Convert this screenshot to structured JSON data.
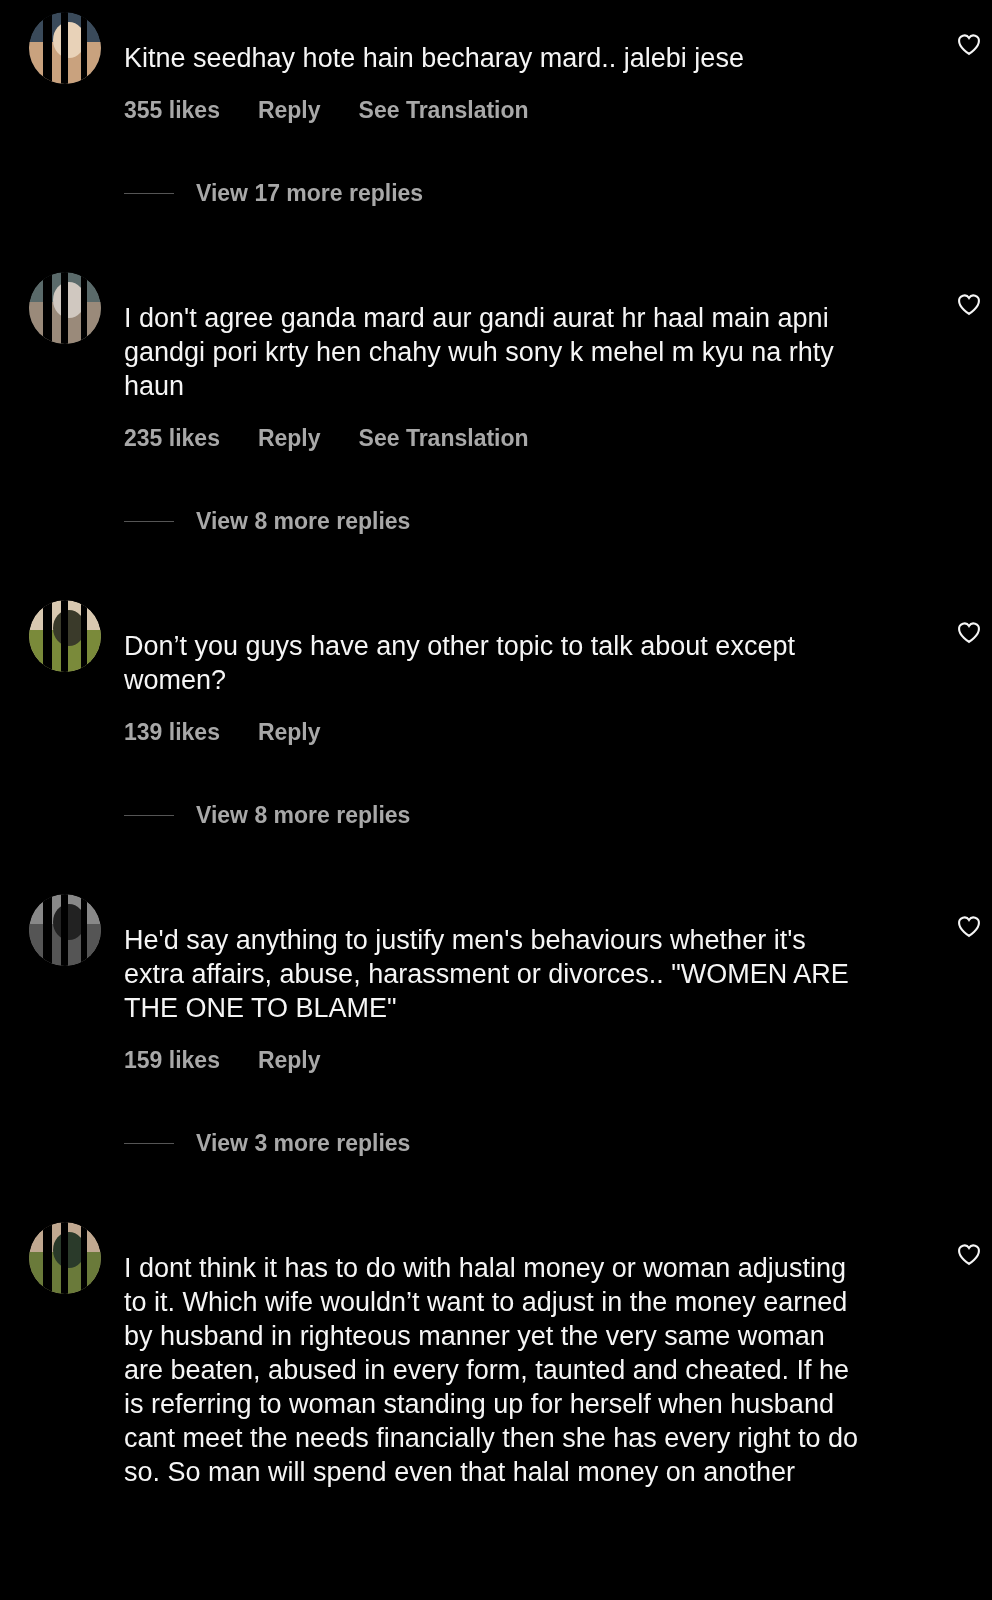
{
  "comments": [
    {
      "text": "Kitne seedhay hote hain becharay mard.. jalebi jese",
      "liked": false,
      "likes": "355 likes",
      "reply": "Reply",
      "translation": "See Translation",
      "more_replies": "View 17 more replies"
    },
    {
      "text": "I don't agree ganda mard aur gandi aurat hr  haal main apni gandgi pori krty hen chahy wuh sony k mehel m kyu na rhty haun",
      "liked": false,
      "likes": "235 likes",
      "reply": "Reply",
      "translation": "See Translation",
      "more_replies": "View 8 more replies"
    },
    {
      "text": "Don’t you guys have any other topic to talk about except women?",
      "liked": false,
      "likes": "139 likes",
      "reply": "Reply",
      "more_replies": "View 8 more replies"
    },
    {
      "text": "He'd say anything to justify men's behaviours whether it's extra affairs, abuse, harassment or divorces.. \"WOMEN ARE THE ONE TO BLAME\"",
      "liked": false,
      "likes": "159 likes",
      "reply": "Reply",
      "more_replies": "View 3 more replies"
    },
    {
      "text": "I dont think it has to do with halal money or woman adjusting to it. Which wife wouldn’t want to adjust in the money earned by husband in righteous manner yet the very same woman are beaten, abused in every form, taunted and cheated. If he is referring to woman standing up for herself when husband cant meet the needs financially then she has every right to do so. So man will spend even that halal money on another",
      "liked": false
    }
  ]
}
